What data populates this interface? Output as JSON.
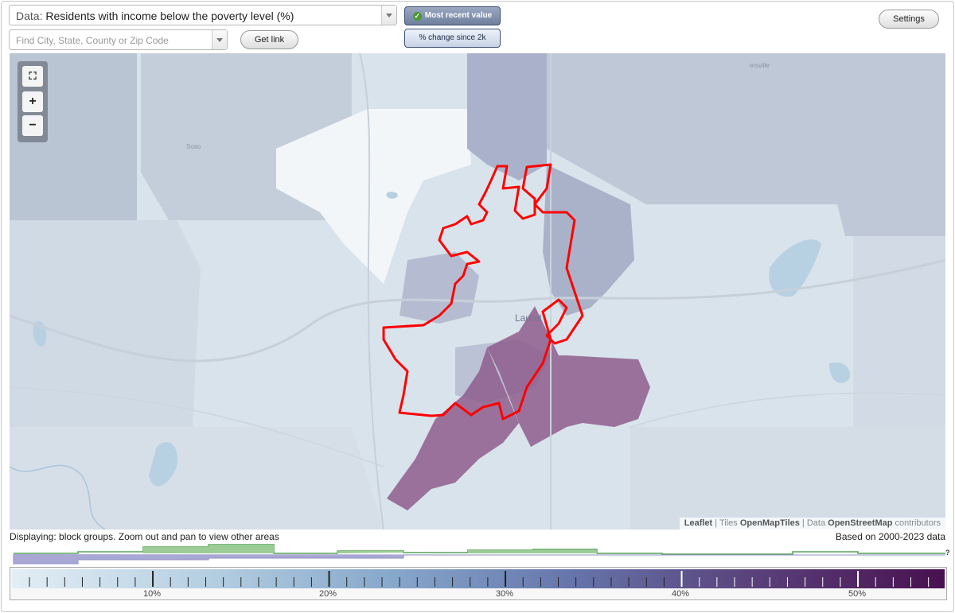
{
  "data_select": {
    "prefix": "Data:",
    "value": "Residents with income below the poverty level (%)"
  },
  "search": {
    "placeholder": "Find City, State, County or Zip Code"
  },
  "buttons": {
    "get_link": "Get link",
    "settings": "Settings"
  },
  "toggles": {
    "most_recent": "Most recent value",
    "pct_change": "% change since 2k"
  },
  "map": {
    "labels": {
      "city": "Laurel",
      "soso": "Soso",
      "ellisville": "ersville"
    },
    "colors": {
      "city_boundary": "#ff0000",
      "high_poverty": "#8e5d8c",
      "mid": "#a6adc8",
      "low": "#eef2f6"
    }
  },
  "zoom": {
    "fit": "⛶",
    "zoom_in": "+",
    "zoom_out": "−"
  },
  "attribution": {
    "leaflet": "Leaflet",
    "tiles_text": "Tiles",
    "tiles_source": "OpenMapTiles",
    "data_text": "Data",
    "data_source": "OpenStreetMap",
    "contributors": "contributors"
  },
  "status": {
    "displaying": "Displaying: block groups. Zoom out and pan to view other areas",
    "based_on": "Based on 2000-2023 data"
  },
  "legend": {
    "ticks": [
      "10%",
      "20%",
      "30%",
      "40%",
      "50%"
    ],
    "help": "?"
  }
}
